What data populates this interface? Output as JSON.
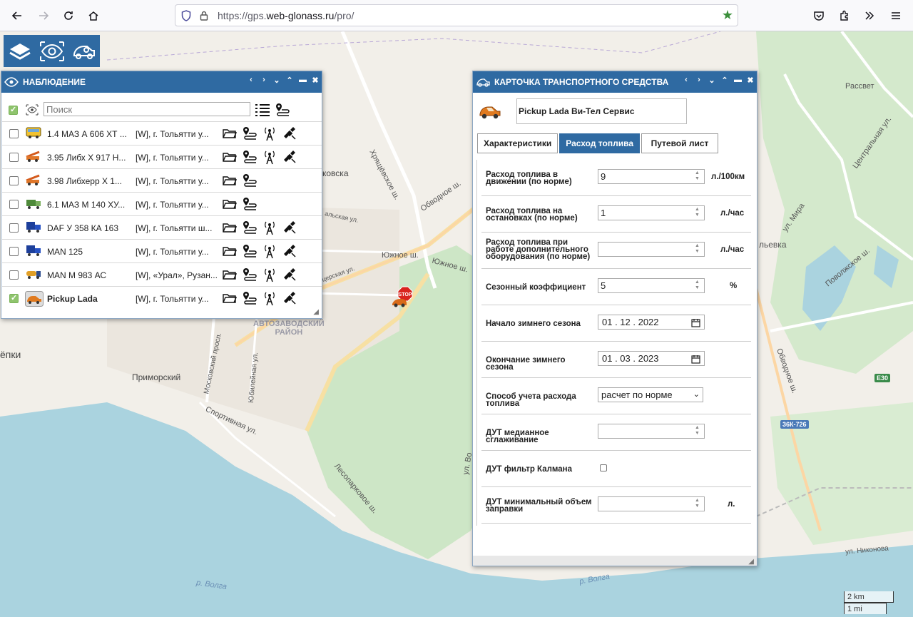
{
  "browser": {
    "url_prefix": "https://gps.",
    "url_domain": "web-glonass.ru",
    "url_path": "/pro/"
  },
  "toolbar": {
    "items": [
      "layers-icon",
      "eye-icon",
      "vehicle-settings-icon"
    ]
  },
  "map": {
    "labels": {
      "rassvet": "Рассвет",
      "central_st": "Центральная ул.",
      "mira_st": "ул. Мира",
      "hryashchevskoe": "Хрящёвское ш.",
      "obvodnoe": "Обводное ш.",
      "kovska": "ковска",
      "yuzhnoe1": "Южное ш.",
      "yuzhnoe2": "Южное ш.",
      "lskaya": "льевка",
      "povolzhskoe": "Поволжское ш.",
      "kalskaya": "альская ул.",
      "tserskaya": "церская ул.",
      "district": "АВТОЗАВОДСКИЙ\nРАЙОН",
      "lepki": "ёпки",
      "primorsky": "Приморский",
      "moskovsky": "Московский просп.",
      "yubileynaya": "Юбилейная ул.",
      "sportivnaya": "Спортивная ул.",
      "lesoparkovoe": "Лесопарковое ш.",
      "obvodnoe2": "Обводное ш.",
      "nikonova": "ул. Никонова",
      "volga1": "р. Волга",
      "volga2": "р. Волга",
      "vo": "ул. Во",
      "shield_e30": "E30",
      "shield_36k": "36К-726"
    },
    "scale_km": "2 km",
    "scale_mi": "1 mi"
  },
  "observation": {
    "title": "НАБЛЮДЕНИЕ",
    "search_placeholder": "Поиск",
    "vehicles": [
      {
        "name": "1.4 МАЗ А 606 ХТ ...",
        "address": "[W], г. Тольятти у...",
        "checked": false,
        "icon": "bus-icon"
      },
      {
        "name": "3.95 Либх Х 917 Н...",
        "address": "[W], г. Тольятти у...",
        "checked": false,
        "icon": "crane-truck-icon"
      },
      {
        "name": "3.98 Либхерр Х 1...",
        "address": "[W], г. Тольятти у...",
        "checked": false,
        "icon": "crane-truck-icon"
      },
      {
        "name": "6.1 МАЗ М 140 ХУ...",
        "address": "[W], г. Тольятти у...",
        "checked": false,
        "icon": "dump-truck-icon"
      },
      {
        "name": "DAF У 358 КА 163",
        "address": "[W], г. Тольятти ш...",
        "checked": false,
        "icon": "box-truck-icon"
      },
      {
        "name": "MAN 125",
        "address": "[W], г. Тольятти у...",
        "checked": false,
        "icon": "box-truck-icon"
      },
      {
        "name": "MAN М 983 АС",
        "address": "[W], «Урал», Рузан...",
        "checked": false,
        "icon": "tanker-truck-icon"
      },
      {
        "name": "Pickup Lada",
        "address": "[W], г. Тольятти у...",
        "checked": true,
        "icon": "pickup-icon"
      }
    ]
  },
  "card": {
    "title": "КАРТОЧКА ТРАНСПОРТНОГО СРЕДСТВА",
    "vehicle_name": "Pickup Lada Ви-Тел Сервис",
    "tabs": [
      "Характеристики",
      "Расход топлива",
      "Путевой лист"
    ],
    "active_tab": "Расход топлива",
    "fields": [
      {
        "label": "Расход топлива в движении (по норме)",
        "value": "9",
        "unit": "л./100км",
        "type": "number"
      },
      {
        "label": "Расход топлива на остановках (по норме)",
        "value": "1",
        "unit": "л./час",
        "type": "number"
      },
      {
        "label": "Расход топлива при работе дополнительного оборудования (по норме)",
        "value": "",
        "unit": "л./час",
        "type": "number"
      },
      {
        "label": "Сезонный коэффициент",
        "value": "5",
        "unit": "%",
        "type": "number"
      },
      {
        "label": "Начало зимнего сезона",
        "value": "01 . 12 . 2022",
        "unit": "",
        "type": "date"
      },
      {
        "label": "Окончание зимнего сезона",
        "value": "01 . 03 . 2023",
        "unit": "",
        "type": "date"
      },
      {
        "label": "Способ учета расхода топлива",
        "value": "расчет по норме",
        "unit": "",
        "type": "select"
      },
      {
        "label": "ДУТ медианное сглаживание",
        "value": "",
        "unit": "",
        "type": "number"
      },
      {
        "label": "ДУТ фильтр Калмана",
        "value": "",
        "unit": "",
        "type": "checkbox"
      },
      {
        "label": "ДУТ минимальный объем заправки",
        "value": "",
        "unit": "л.",
        "type": "number"
      }
    ]
  },
  "marker": {
    "stop_label": "STOP"
  },
  "colors": {
    "accent": "#2f6aa2",
    "check": "#8fc46d",
    "water": "#aad3df",
    "forest": "#cde6c6"
  }
}
